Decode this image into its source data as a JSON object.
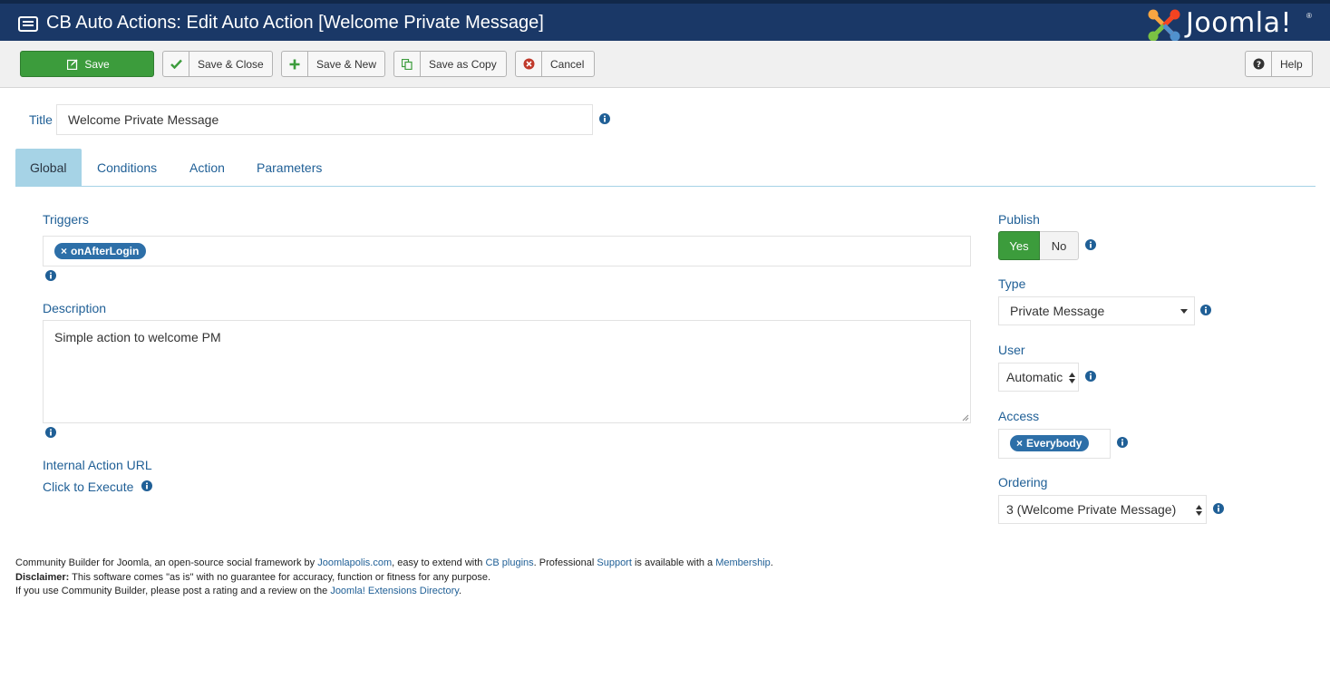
{
  "header": {
    "title": "CB Auto Actions: Edit Auto Action [Welcome Private Message]",
    "logo_text": "Joomla!",
    "logo_reg": "®",
    "bar_color": "#1a3867"
  },
  "toolbar": {
    "save": "Save",
    "save_close": "Save & Close",
    "save_new": "Save & New",
    "save_copy": "Save as Copy",
    "cancel": "Cancel",
    "help": "Help",
    "save_color": "#3c9c3c"
  },
  "form": {
    "title_label": "Title",
    "title_value": "Welcome Private Message"
  },
  "tabs": [
    {
      "label": "Global",
      "active": true
    },
    {
      "label": "Conditions",
      "active": false
    },
    {
      "label": "Action",
      "active": false
    },
    {
      "label": "Parameters",
      "active": false
    }
  ],
  "left": {
    "triggers_label": "Triggers",
    "trigger_chip": "onAfterLogin",
    "chip_remove": "×",
    "description_label": "Description",
    "description_value": "Simple action to welcome PM",
    "internal_url_label": "Internal Action URL",
    "execute_link": "Click to Execute"
  },
  "right": {
    "publish_label": "Publish",
    "publish_yes": "Yes",
    "publish_no": "No",
    "type_label": "Type",
    "type_value": "Private Message",
    "user_label": "User",
    "user_value": "Automatic",
    "access_label": "Access",
    "access_chip": "Everybody",
    "ordering_label": "Ordering",
    "ordering_value": "3 (Welcome Private Message)"
  },
  "footer": {
    "line1_a": "Community Builder for Joomla, an open-source social framework by ",
    "line1_link1": "Joomlapolis.com",
    "line1_b": ", easy to extend with ",
    "line1_link2": "CB plugins",
    "line1_c": ". Professional ",
    "line1_link3": "Support",
    "line1_d": " is available with a ",
    "line1_link4": "Membership",
    "line1_e": ".",
    "disclaimer_label": "Disclaimer:",
    "disclaimer_text": " This software comes \"as is\" with no guarantee for accuracy, function or fitness for any purpose.",
    "line3_a": "If you use Community Builder, please post a rating and a review on the ",
    "line3_link": "Joomla! Extensions Directory",
    "line3_b": "."
  }
}
